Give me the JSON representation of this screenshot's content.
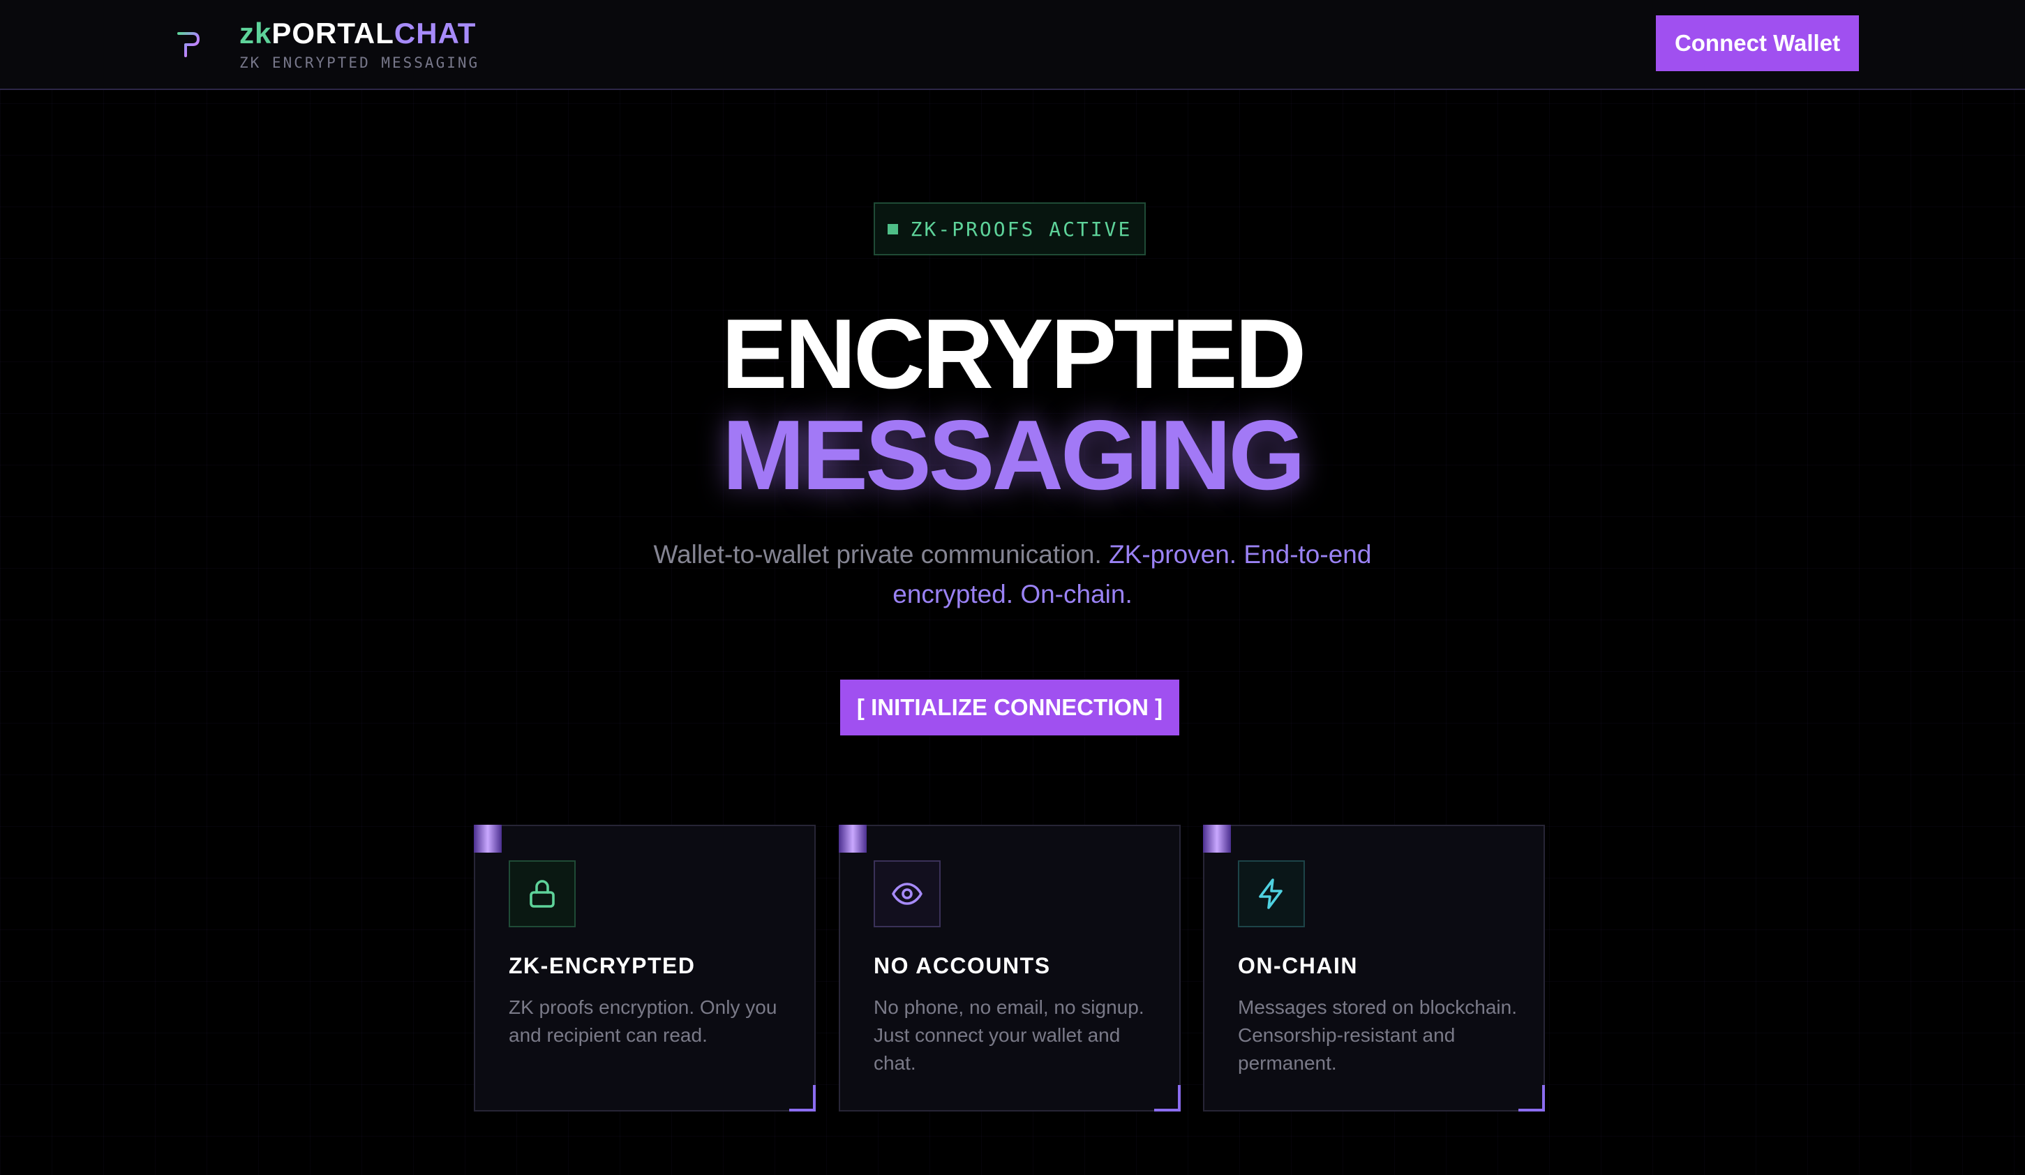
{
  "header": {
    "brand_zk": "zk",
    "brand_portal": "PORTAL",
    "brand_chat": "CHAT",
    "tagline": "ZK ENCRYPTED MESSAGING",
    "connect_label": "Connect Wallet"
  },
  "hero": {
    "status": "ZK-PROOFS ACTIVE",
    "line1": "ENCRYPTED",
    "line2": "MESSAGING",
    "subtitle_plain": "Wallet-to-wallet private communication.",
    "subtitle_accent": "ZK-proven. End-to-end encrypted. On-chain.",
    "cta_label": "[ INITIALIZE CONNECTION ]"
  },
  "features": [
    {
      "icon": "lock-icon",
      "title": "ZK-ENCRYPTED",
      "text": "ZK proofs encryption. Only you and recipient can read."
    },
    {
      "icon": "eye-icon",
      "title": "NO ACCOUNTS",
      "text": "No phone, no email, no signup. Just connect your wallet and chat."
    },
    {
      "icon": "zap-icon",
      "title": "ON-CHAIN",
      "text": "Messages stored on blockchain. Censorship-resistant and permanent."
    }
  ],
  "colors": {
    "background": "#000000",
    "accent_purple": "#a050f0",
    "brand_green": "#5ed39a",
    "brand_violet": "#a78bfa",
    "icon_cyan": "#4fd1e0"
  }
}
